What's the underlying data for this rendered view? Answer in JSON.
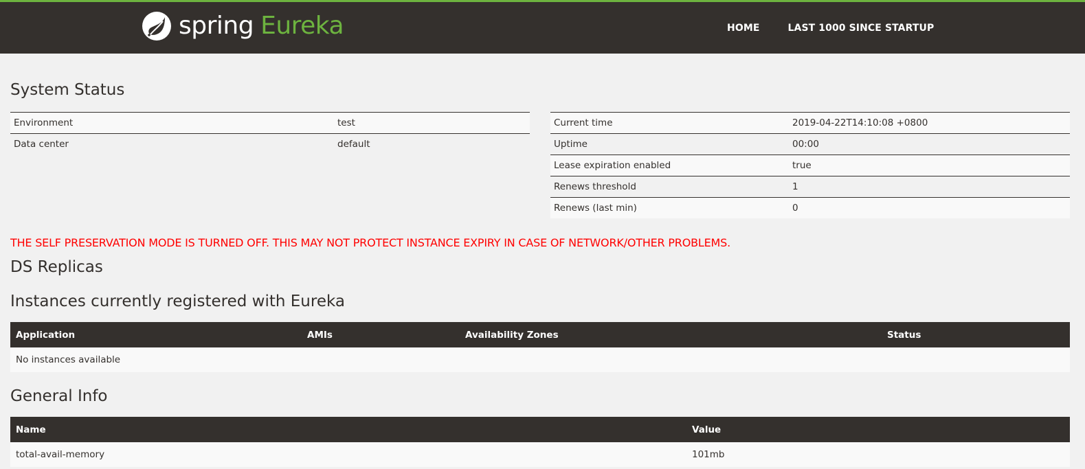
{
  "navbar": {
    "brand_spring": "spring",
    "brand_eureka": "Eureka",
    "links": [
      "HOME",
      "LAST 1000 SINCE STARTUP"
    ],
    "accent_color": "#6db33f",
    "background_color": "#34302d"
  },
  "system_status": {
    "title": "System Status",
    "left_rows": [
      {
        "key": "Environment",
        "value": "test"
      },
      {
        "key": "Data center",
        "value": "default"
      }
    ],
    "right_rows": [
      {
        "key": "Current time",
        "value": "2019-04-22T14:10:08 +0800"
      },
      {
        "key": "Uptime",
        "value": "00:00"
      },
      {
        "key": "Lease expiration enabled",
        "value": "true"
      },
      {
        "key": "Renews threshold",
        "value": "1"
      },
      {
        "key": "Renews (last min)",
        "value": "0"
      }
    ]
  },
  "warning": {
    "text": "THE SELF PRESERVATION MODE IS TURNED OFF. THIS MAY NOT PROTECT INSTANCE EXPIRY IN CASE OF NETWORK/OTHER PROBLEMS.",
    "color": "#ff0000"
  },
  "ds_replicas": {
    "title": "DS Replicas"
  },
  "instances": {
    "title": "Instances currently registered with Eureka",
    "columns": [
      "Application",
      "AMIs",
      "Availability Zones",
      "Status"
    ],
    "empty_message": "No instances available"
  },
  "general_info": {
    "title": "General Info",
    "columns": [
      "Name",
      "Value"
    ],
    "rows": [
      {
        "name": "total-avail-memory",
        "value": "101mb"
      }
    ]
  }
}
